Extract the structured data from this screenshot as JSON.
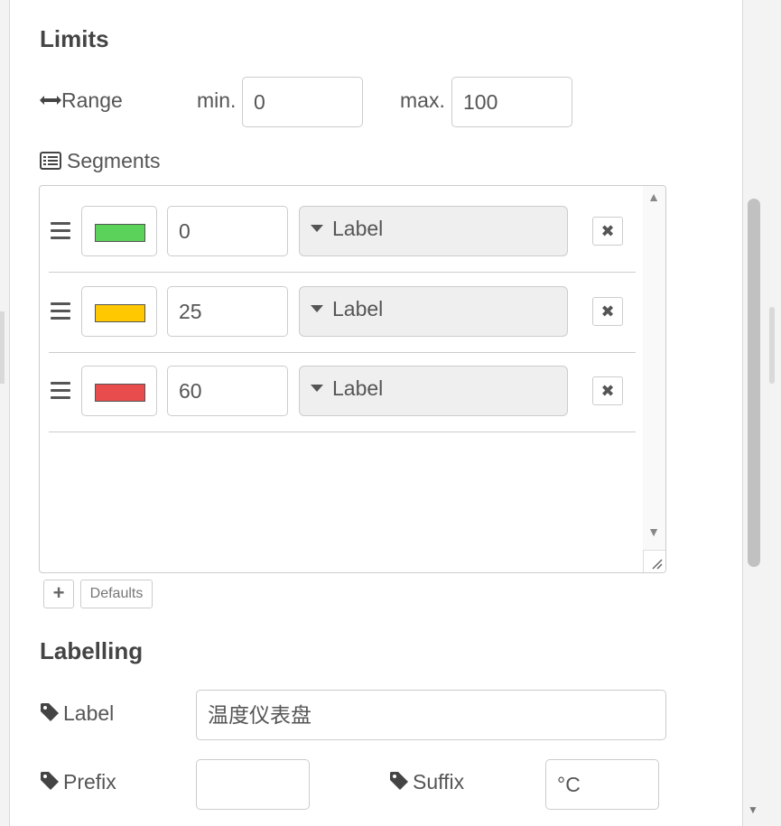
{
  "limits": {
    "heading": "Limits",
    "range_label": "Range",
    "min_label": "min.",
    "min_value": "0",
    "max_label": "max.",
    "max_value": "100",
    "segments_label": "Segments",
    "segments": [
      {
        "color": "#5bd35b",
        "value": "0",
        "type_label": "Label"
      },
      {
        "color": "#ffc800",
        "value": "25",
        "type_label": "Label"
      },
      {
        "color": "#e84c4c",
        "value": "60",
        "type_label": "Label"
      }
    ],
    "add_label": "+",
    "defaults_label": "Defaults"
  },
  "labelling": {
    "heading": "Labelling",
    "label_label": "Label",
    "label_value": "温度仪表盘",
    "prefix_label": "Prefix",
    "prefix_value": "",
    "suffix_label": "Suffix",
    "suffix_value": "°C"
  },
  "icons": {
    "range": "arrows-h-icon",
    "segments": "list-alt-icon",
    "tag": "tag-icon",
    "drag": "bars-icon",
    "delete": "times-icon"
  }
}
